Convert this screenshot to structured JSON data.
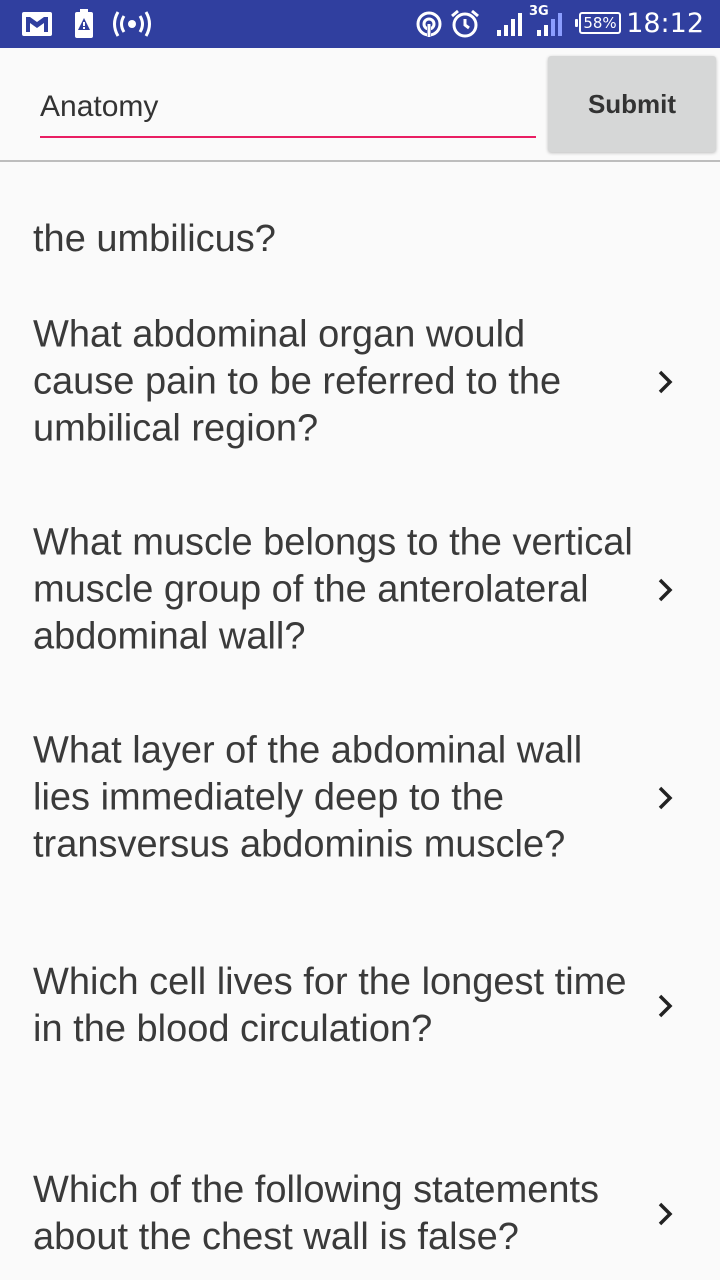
{
  "status_bar": {
    "time": "18:12",
    "battery": "58%",
    "network_type": "3G",
    "icons": [
      "gmail-icon",
      "warning-icon",
      "hotspot-icon",
      "nfc-icon",
      "alarm-icon",
      "signal-icon",
      "signal-3g-icon",
      "battery-icon"
    ]
  },
  "header": {
    "search_value": "Anatomy",
    "submit_label": "Submit"
  },
  "questions": [
    {
      "text": "the umbilicus?"
    },
    {
      "text": "What abdominal organ would cause pain to be referred to the umbilical region?"
    },
    {
      "text": "What muscle belongs to the vertical muscle group of the anterolateral abdominal wall?"
    },
    {
      "text": "What layer of the abdominal wall lies immediately deep to the transversus abdominis muscle?"
    },
    {
      "text": "Which cell lives for the longest time in the blood circulation?"
    },
    {
      "text": "Which of the following statements about the chest wall is false?"
    }
  ],
  "colors": {
    "status_bar": "#303f9f",
    "accent": "#e91e63",
    "button": "#d6d7d7",
    "text": "#3a3a3a"
  }
}
